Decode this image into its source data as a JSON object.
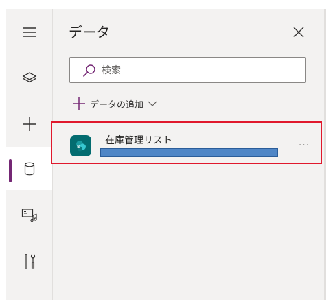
{
  "panel": {
    "title": "データ",
    "close_icon": "close-icon"
  },
  "rail": {
    "items": [
      {
        "name": "menu",
        "icon": "hamburger-icon",
        "active": false
      },
      {
        "name": "layers",
        "icon": "layers-icon",
        "active": false
      },
      {
        "name": "insert",
        "icon": "plus-icon",
        "active": false
      },
      {
        "name": "data",
        "icon": "database-icon",
        "active": true
      },
      {
        "name": "media",
        "icon": "media-icon",
        "active": false
      },
      {
        "name": "tools",
        "icon": "tools-icon",
        "active": false
      }
    ],
    "active_color": "#742774"
  },
  "search": {
    "placeholder": "検索",
    "value": ""
  },
  "add_data": {
    "label": "データの追加"
  },
  "data_sources": [
    {
      "name": "在庫管理リスト",
      "icon": "sharepoint-icon",
      "more": "..."
    }
  ],
  "colors": {
    "highlight_border": "#e0192d",
    "sharepoint": "#036c70",
    "redaction_bar": "#4f86c6"
  }
}
